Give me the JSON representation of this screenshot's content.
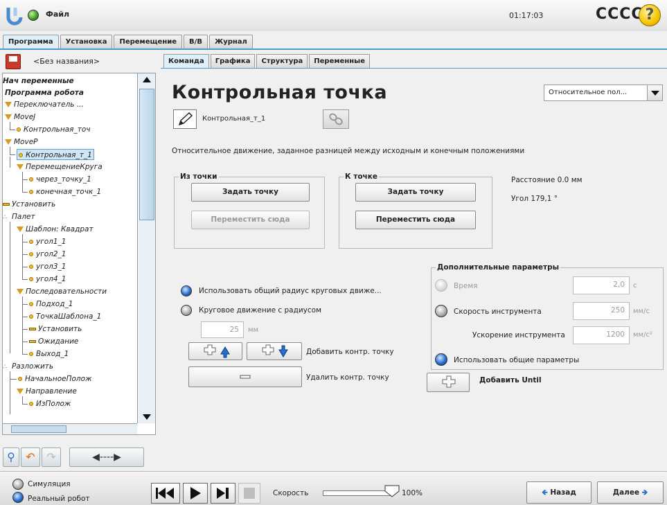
{
  "header": {
    "file_menu": "Файл",
    "clock": "01:17:03",
    "robot_name": "CCCC",
    "help_glyph": "?"
  },
  "main_tabs": [
    {
      "label": "Программа",
      "active": true
    },
    {
      "label": "Установка",
      "active": false
    },
    {
      "label": "Перемещение",
      "active": false
    },
    {
      "label": "В/В",
      "active": false
    },
    {
      "label": "Журнал",
      "active": false
    }
  ],
  "left_panel": {
    "program_name": "<Без названия>",
    "tree": [
      "Нач переменные",
      "Программа робота",
      "Переключатель ...",
      "MoveJ",
      "Контрольная_точ",
      "MoveP",
      "Контрольная_т_1",
      "ПеремещениеКруга",
      "через_точку_1",
      "конечная_точк_1",
      "Установить",
      "Палет",
      "Шаблон: Квадрат",
      "угол1_1",
      "угол2_1",
      "угол3_1",
      "угол4_1",
      "Последовательности",
      "Подход_1",
      "ТочкаШаблона_1",
      "Установить",
      "Ожидание",
      "Выход_1",
      "Разложить",
      "НачальноеПолож",
      "Направление",
      "ИзПолож"
    ]
  },
  "sub_tabs": [
    {
      "label": "Команда",
      "active": true
    },
    {
      "label": "Графика",
      "active": false
    },
    {
      "label": "Структура",
      "active": false
    },
    {
      "label": "Переменные",
      "active": false
    }
  ],
  "command": {
    "title": "Контрольная точка",
    "mode_select": "Относительное пол...",
    "waypoint_name": "Контрольная_т_1",
    "description": "Относительное движение, заданное разницей между исходным и конечным положениями",
    "from_point": {
      "label": "Из точки",
      "set_button": "Задать точку",
      "move_button": "Переместить сюда"
    },
    "to_point": {
      "label": "К точке",
      "set_button": "Задать точку",
      "move_button": "Переместить сюда"
    },
    "distance": "Расстояние 0.0 мм",
    "angle": "Угол 179,1 °",
    "blend_shared": "Использовать общий радиус круговых движе...",
    "blend_radius": "Круговое движение с радиусом",
    "radius_value": "25",
    "radius_unit": "мм",
    "add_waypoint": "Добавить контр. точку",
    "remove_waypoint": "Удалить контр. точку",
    "advanced": {
      "label": "Дополнительные параметры",
      "time_label": "Время",
      "time_value": "2,0",
      "time_unit": "с",
      "tool_speed_label": "Скорость инструмента",
      "tool_speed_value": "250",
      "tool_speed_unit": "мм/с",
      "tool_accel_label": "Ускорение инструмента",
      "tool_accel_value": "1200",
      "tool_accel_unit": "мм/с²",
      "shared_params": "Использовать общие параметры"
    },
    "add_until": "Добавить Until"
  },
  "footer": {
    "simulation": "Симуляция",
    "real_robot": "Реальный робот",
    "speed_label": "Скорость",
    "speed_value": "100%",
    "back": "Назад",
    "next": "Далее"
  },
  "speed_fraction": 1.0
}
